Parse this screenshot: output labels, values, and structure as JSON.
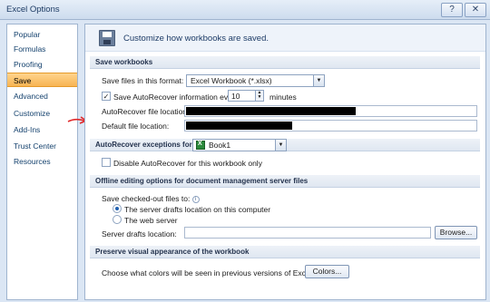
{
  "window": {
    "title": "Excel Options",
    "help_icon": "?",
    "close_icon": "✕"
  },
  "nav": {
    "items": [
      {
        "label": "Popular"
      },
      {
        "label": "Formulas"
      },
      {
        "label": "Proofing"
      },
      {
        "label": "Save"
      },
      {
        "label": "Advanced"
      },
      {
        "label": "Customize"
      },
      {
        "label": "Add-Ins"
      },
      {
        "label": "Trust Center"
      },
      {
        "label": "Resources"
      }
    ],
    "selected": "Save"
  },
  "header": {
    "text": "Customize how workbooks are saved."
  },
  "save_workbooks": {
    "title": "Save workbooks",
    "format_label": "Save files in this format:",
    "format_value": "Excel Workbook (*.xlsx)",
    "autorecover_label": "Save AutoRecover information every",
    "autorecover_checked": true,
    "autorecover_minutes": "10",
    "minutes_label": "minutes",
    "autorecover_location_label": "AutoRecover file location:",
    "default_location_label": "Default file location:"
  },
  "autorecover_exceptions": {
    "title": "AutoRecover exceptions for:",
    "workbook": "Book1",
    "disable_label": "Disable AutoRecover for this workbook only",
    "disable_checked": false
  },
  "offline": {
    "title": "Offline editing options for document management server files",
    "checked_out_label": "Save checked-out files to:",
    "option_server_drafts": "The server drafts location on this computer",
    "option_web_server": "The web server",
    "selected": "server_drafts",
    "server_drafts_label": "Server drafts location:",
    "browse_label": "Browse..."
  },
  "preserve": {
    "title": "Preserve visual appearance of the workbook",
    "colors_prompt": "Choose what colors will be seen in previous versions of Excel:",
    "colors_button": "Colors..."
  },
  "colors": {
    "accent": "#f7b454",
    "annotation_arrow": "#e0282a"
  }
}
